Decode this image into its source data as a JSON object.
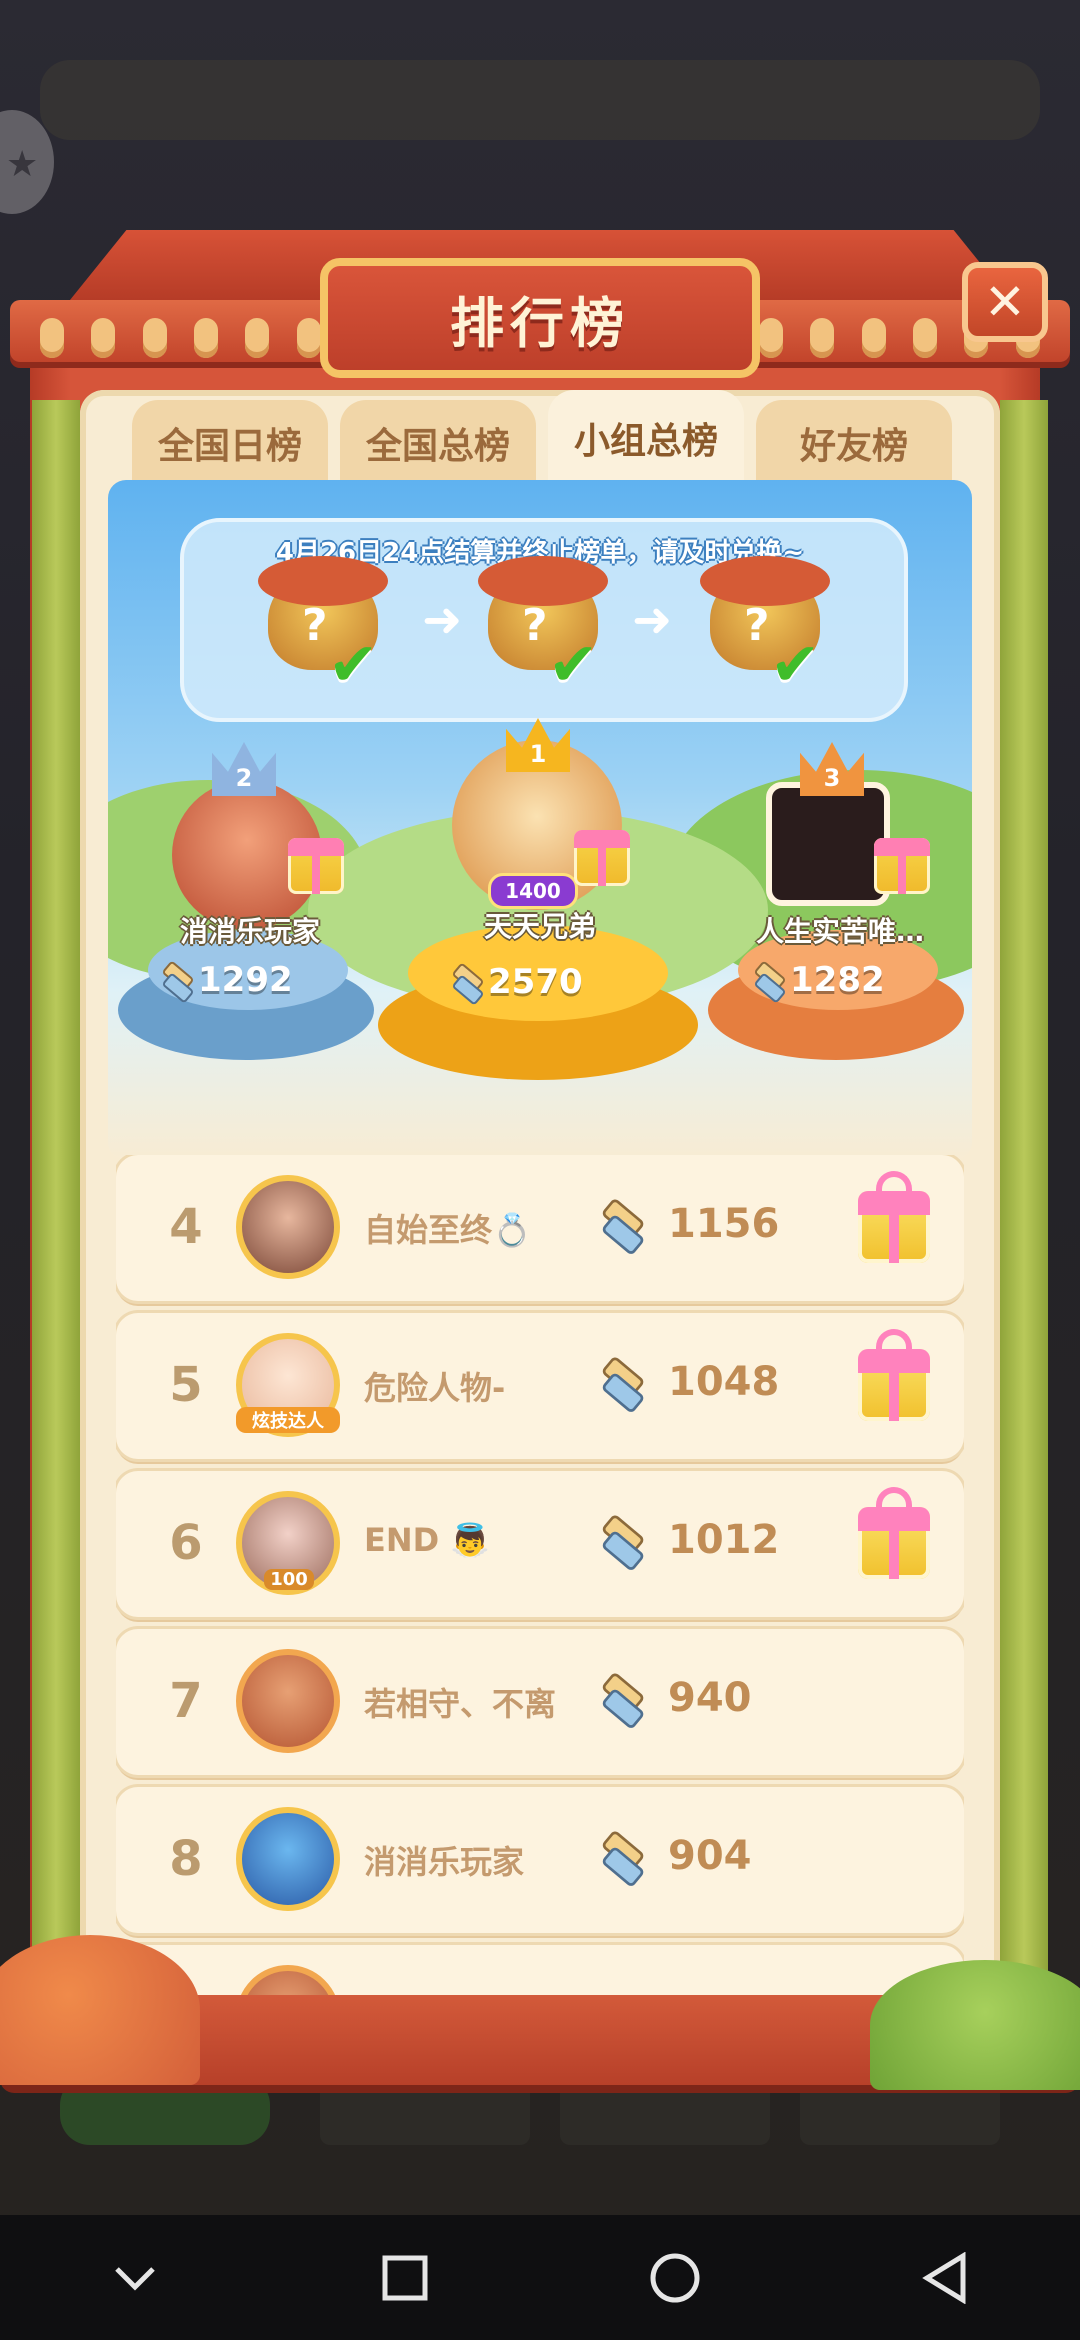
{
  "header": {
    "title": "排行榜",
    "close_icon": "close-icon"
  },
  "tabs": [
    {
      "label": "全国日榜",
      "active": false
    },
    {
      "label": "全国总榜",
      "active": false
    },
    {
      "label": "小组总榜",
      "active": true
    },
    {
      "label": "好友榜",
      "active": false
    }
  ],
  "notice": {
    "text": "4月26日24点结算并终止榜单，请及时兑换~"
  },
  "stages": [
    {
      "symbol": "?",
      "status": "✔"
    },
    {
      "symbol": "?",
      "status": "✔"
    },
    {
      "symbol": "?",
      "status": "✔"
    }
  ],
  "podium": {
    "first": {
      "rank": "1",
      "name": "天天兄弟",
      "score": "2570",
      "badge": "1400"
    },
    "second": {
      "rank": "2",
      "name": "消消乐玩家",
      "score": "1292"
    },
    "third": {
      "rank": "3",
      "name": "人生实苦唯…",
      "score": "1282"
    }
  },
  "rows": [
    {
      "rank": "4",
      "name": "自始至终💍",
      "score": "1156",
      "gift": true
    },
    {
      "rank": "5",
      "name": "危险人物-",
      "score": "1048",
      "gift": true,
      "avatar_tag": "炫技达人"
    },
    {
      "rank": "6",
      "name": "END 👼",
      "score": "1012",
      "gift": true,
      "avatar_tag": "100"
    },
    {
      "rank": "7",
      "name": "若相守、不离",
      "score": "940",
      "gift": false
    },
    {
      "rank": "8",
      "name": "消消乐玩家",
      "score": "904",
      "gift": false
    }
  ],
  "colors": {
    "accent_red": "#d6553a",
    "panel": "#f8ecd3",
    "gold": "#f5c466",
    "podium_gold": "#f6b61f",
    "podium_blue": "#7fb3dc",
    "podium_orange": "#f29a57"
  },
  "navbar": {
    "back_icon": "chevron-down-icon",
    "recent_icon": "square-icon",
    "home_icon": "circle-icon",
    "return_icon": "triangle-back-icon"
  }
}
